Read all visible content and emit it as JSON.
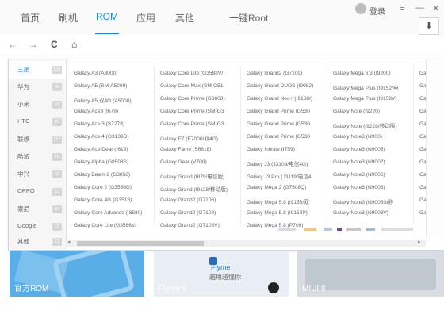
{
  "nav": {
    "tabs": [
      "首页",
      "刷机",
      "ROM",
      "应用",
      "其他",
      "一键Root"
    ],
    "active_tab": "ROM",
    "login_label": "登录",
    "menu_icon": "≡",
    "minimize_icon": "—",
    "close_icon": "✕"
  },
  "toolbar": {
    "back": "←",
    "forward": "→",
    "refresh": "C",
    "home": "⌂",
    "download": "⬇"
  },
  "brands": [
    {
      "name": "三星",
      "count": "137"
    },
    {
      "name": "华为",
      "count": "66"
    },
    {
      "name": "小米",
      "count": "31"
    },
    {
      "name": "HTC",
      "count": "45"
    },
    {
      "name": "联想",
      "count": "117"
    },
    {
      "name": "酷派",
      "count": "78"
    },
    {
      "name": "中兴",
      "count": "56"
    },
    {
      "name": "OPPO",
      "count": "22"
    },
    {
      "name": "索尼",
      "count": "34"
    },
    {
      "name": "Google",
      "count": "7"
    },
    {
      "name": "其他",
      "count": "21"
    }
  ],
  "active_brand": "三星",
  "models": [
    [
      "Galaxy A3 (A3000)",
      "Galaxy A5 (SM-A5009)",
      "Galaxy A5 双4G (A5000)",
      "Galaxy Ace3 (I679)",
      "Galaxy Ace 3 (S7278)",
      "Galaxy Ace 4 (G3139D)",
      "Galaxy Ace Dear (I619)",
      "Galaxy Alpha (G8508S)",
      "Galaxy Beam 2 (G3858)",
      "Galaxy Core 2 (G3556D)",
      "Galaxy Core 4G (G3518)",
      "Galaxy Core Advance (I8580)",
      "Galaxy Core Lite (G3586V/"
    ],
    [
      "Galaxy Core Lite (G3588V/",
      "Galaxy Core Max (SM-G51",
      "Galaxy Core Prime (G3608)",
      "Galaxy Core Prime (SM-G3",
      "Galaxy Core Prime (SM-G3",
      "Galaxy E7 (E7000/双4G)",
      "Galaxy Fame (S6818)",
      "Galaxy Gear (V700)",
      "Galaxy Grand (I879/电信版)",
      "Galaxy Grand (I9128/移动版)",
      "Galaxy Grand2 (G7106)",
      "Galaxy Grand2 (G7108)",
      "Galaxy Grand2 (G7108V)"
    ],
    [
      "Galaxy Grand2 (G7109)",
      "Galaxy Grand DUOS (I9082)",
      "Galaxy Grand Neo+ (I9168I)",
      "Galaxy Grand Prime (G530",
      "Galaxy Grand Prime (G530",
      "Galaxy Grand Prime (G530",
      "Galaxy Infinite (I759)",
      "Galaxy J3 (J3109/电信4G)",
      "Galaxy J3 Pro (J3119/电信4",
      "Galaxy Mega 2 (G7508Q)",
      "Galaxy Mega 5.8 (I9158/双",
      "Galaxy Mega 5.8 (I9158P)",
      "Galaxy Mega 5.8 (P709)"
    ],
    [
      "Galaxy Mega 6.3 (I9200)",
      "Galaxy Mega Plus (I9152/电",
      "Galaxy Mega Plus (I9158V)",
      "Galaxy Note (I9220)",
      "Galaxy Note (I9228/移动版)",
      "Galaxy Note3 (N900)",
      "Galaxy Note3 (N9005)",
      "Galaxy Note3 (N9002)",
      "Galaxy Note3 (N9006)",
      "Galaxy Note3 (N9008)",
      "Galaxy Note3 (N9008S/移",
      "Galaxy Note3 (N9008V)",
      ""
    ],
    [
      "Galaxy",
      "Galaxy",
      "Galaxy",
      "Galaxy",
      "Galaxy",
      "Galaxy",
      "Galaxy",
      "Galaxy",
      "Galaxy",
      "Galaxy",
      "Galaxy",
      "Galaxy",
      ""
    ]
  ],
  "cards": [
    {
      "label": "官方ROM"
    },
    {
      "label": "Flyme 6",
      "brand": "Flyme",
      "tagline": "越用越懂你"
    },
    {
      "label": "MIUI 8"
    }
  ],
  "colors": {
    "accent": "#1a8be0"
  }
}
